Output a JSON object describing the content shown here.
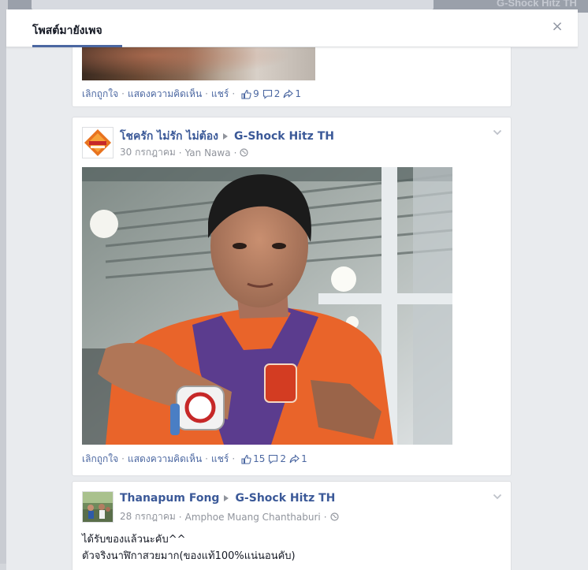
{
  "background": {
    "page_title_ghost": "G-Shock Hitz TH"
  },
  "modal": {
    "tab_label": "โพสต์มายังเพจ",
    "close_glyph": "×"
  },
  "posts": [
    {
      "actions": {
        "unlike": "เลิกถูกใจ",
        "comments": "แสดงความคิดเห็น",
        "share": "แชร์",
        "likes_count": "9",
        "comments_count": "2",
        "shares_count": "1"
      }
    },
    {
      "author": "โชครัก ไม่รัก ไม่ต้อง",
      "target_page": "G-Shock Hitz TH",
      "date": "30 กรกฎาคม",
      "location": "Yan Nawa",
      "actions": {
        "unlike": "เลิกถูกใจ",
        "comments": "แสดงความคิดเห็น",
        "share": "แชร์",
        "likes_count": "15",
        "comments_count": "2",
        "shares_count": "1"
      }
    },
    {
      "author": "Thanapum Fong",
      "target_page": "G-Shock Hitz TH",
      "date": "28 กรกฎาคม",
      "location": "Amphoe Muang Chanthaburi",
      "text_lines": [
        "ได้รับของแล้วนะคับ^^",
        "ตัวจริงนาฬิกาสวยมาก(ของแท้100%แน่นอนคับ)"
      ]
    }
  ],
  "colors": {
    "link": "#4b67a1",
    "author": "#3b5998",
    "meta": "#90949c",
    "tab_underline": "#4b67a1"
  }
}
